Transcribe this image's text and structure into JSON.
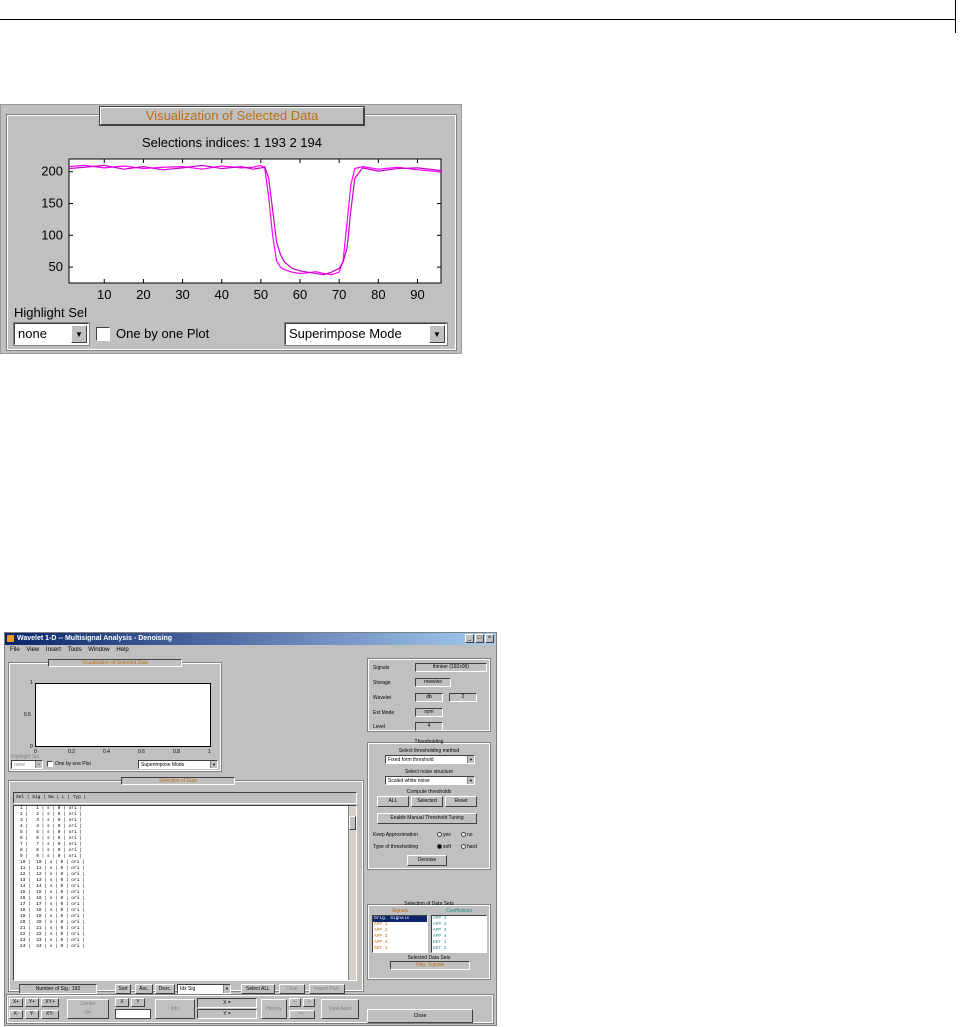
{
  "figure1": {
    "title": "Visualization of Selected Data",
    "selection_text": "Selections indices: 1  193    2  194",
    "highlight_label": "Highlight Sel",
    "highlight_value": "none",
    "one_by_one_label": "One by one Plot",
    "mode_value": "Superimpose Mode"
  },
  "chart_data": {
    "type": "line",
    "title": "Selections indices: 1  193    2  194",
    "xlim": [
      1,
      96
    ],
    "ylim": [
      25,
      220
    ],
    "x_ticks": [
      10,
      20,
      30,
      40,
      50,
      60,
      70,
      80,
      90
    ],
    "y_ticks": [
      50,
      100,
      150,
      200
    ],
    "grid": false,
    "colors": [
      "#ff00ff",
      "#cc00cc"
    ],
    "series": [
      {
        "x": [
          1,
          5,
          10,
          15,
          20,
          25,
          30,
          35,
          40,
          45,
          48,
          50,
          51,
          52,
          53,
          54,
          55,
          56,
          58,
          60,
          62,
          64,
          66,
          68,
          70,
          71,
          72,
          73,
          74,
          76,
          80,
          85,
          90,
          96
        ],
        "values": [
          208,
          210,
          206,
          209,
          205,
          207,
          208,
          204,
          209,
          206,
          207,
          210,
          205,
          160,
          100,
          60,
          50,
          46,
          42,
          40,
          41,
          43,
          40,
          38,
          42,
          60,
          120,
          180,
          205,
          208,
          204,
          207,
          203,
          200
        ]
      },
      {
        "x": [
          1,
          5,
          10,
          15,
          20,
          25,
          30,
          35,
          40,
          45,
          48,
          50,
          51,
          52,
          53,
          54,
          55,
          56,
          58,
          60,
          62,
          64,
          66,
          68,
          70,
          71,
          72,
          73,
          74,
          76,
          80,
          85,
          90,
          96
        ],
        "values": [
          205,
          207,
          210,
          204,
          208,
          203,
          206,
          210,
          205,
          208,
          204,
          206,
          208,
          190,
          140,
          90,
          70,
          58,
          48,
          44,
          42,
          40,
          38,
          42,
          48,
          58,
          80,
          140,
          190,
          206,
          201,
          205,
          206,
          202
        ]
      }
    ]
  },
  "window": {
    "title": "Wavelet 1-D  --  Multisignal Analysis - Denoising",
    "menus": [
      "File",
      "View",
      "Insert",
      "Tools",
      "Window",
      "Help"
    ],
    "vis_title": "Visualization of Selected Data",
    "mini_axes": {
      "y": [
        "1",
        "0.5",
        "0"
      ],
      "x": [
        "0",
        "0.2",
        "0.4",
        "0.6",
        "0.8",
        "1"
      ]
    },
    "highlight_label": "Highlight Sel",
    "highlight_value": "none",
    "one_by_one": "One by one Plot",
    "mode": "Superimpose Mode",
    "selection_title": "Selection of Data",
    "table_header": "Sel | Sig | Dw | L | Typ |",
    "rows": [
      "1 |   1 | s | 0 | ori |",
      "2 |   2 | s | 0 | ori |",
      "3 |   3 | s | 0 | ori |",
      "4 |   4 | s | 0 | ori |",
      "5 |   5 | s | 0 | ori |",
      "6 |   6 | s | 0 | ori |",
      "7 |   7 | s | 0 | ori |",
      "8 |   8 | s | 0 | ori |",
      "9 |   9 | s | 0 | ori |",
      "10 |  10 | s | 0 | ori |",
      "11 |  11 | s | 0 | ori |",
      "12 |  12 | s | 0 | ori |",
      "13 |  13 | s | 0 | ori |",
      "14 |  14 | s | 0 | ori |",
      "15 |  15 | s | 0 | ori |",
      "16 |  16 | s | 0 | ori |",
      "17 |  17 | s | 0 | ori |",
      "18 |  18 | s | 0 | ori |",
      "19 |  19 | s | 0 | ori |",
      "20 |  20 | s | 0 | ori |",
      "21 |  21 | s | 0 | ori |",
      "22 |  22 | s | 0 | ori |",
      "23 |  23 | s | 0 | ori |",
      "24 |  24 | s | 0 | ori |"
    ],
    "num_sig": "Number of Sig.: 192",
    "sort": "Sort",
    "asc": "Asc.",
    "desc": "Desc.",
    "sort_field": "Idx Sig",
    "select_all": "Select ALL",
    "clear": "Clear",
    "import_part": "Import Part.",
    "info": {
      "signals_l": "Signals",
      "signals_v": "thinker (192x96)",
      "storage_l": "Storage",
      "storage_v": "rowwise",
      "wavelet_l": "Wavelet",
      "wavelet_v": "db",
      "wavelet_n": "2",
      "extmode_l": "Ext Mode",
      "extmode_v": "sym",
      "level_l": "Level",
      "level_v": "4"
    },
    "thr": {
      "title": "Thresholding",
      "method_label": "Select thresholding method",
      "method": "Fixed form threshold",
      "noise_label": "Select noise structure",
      "noise": "Scaled white noise",
      "compute_label": "Compute thresholds",
      "all": "ALL",
      "selected": "Selected",
      "reset": "Reset",
      "manual": "Enable Manual Threshold Tuning",
      "keep_label": "Keep Approximation",
      "yes": "yes",
      "no": "no",
      "type_label": "Type of thresholding",
      "soft": "soft",
      "hard": "hard",
      "denoise": "Denoise"
    },
    "sets": {
      "title": "Selection of Data Sets",
      "signals_head": "Signals",
      "coef_head": "Coefficients",
      "signals": [
        "Orig. Signals",
        "APP 1",
        "APP 2",
        "APP 3",
        "APP 4",
        "DET 1"
      ],
      "coefs": [
        "APP 1",
        "APP 2",
        "APP 3",
        "APP 4",
        "DET 1",
        "DET 2"
      ],
      "selected_label": "Selected Data Sets",
      "selected_value": "Orig. Signals"
    },
    "bottom": {
      "center": "Center",
      "on": "On",
      "info": "Info",
      "x": "X =",
      "y": "Y =",
      "history": "History",
      "view_axes": "View Axes",
      "close": "Close",
      "xx": "X+",
      "yy": "Y+",
      "xy": "XY+",
      "xm": "X-",
      "ym": "Y-",
      "xym": "XY-",
      "X": "X",
      "Y": "Y"
    }
  }
}
